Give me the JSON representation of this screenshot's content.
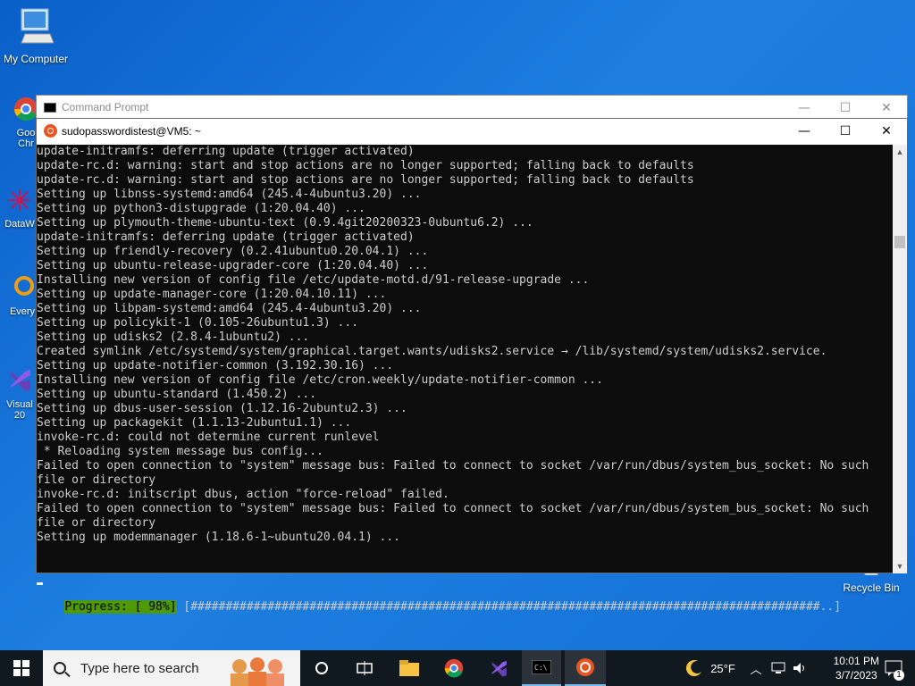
{
  "desktop": {
    "icons": [
      {
        "label": "My Computer"
      },
      {
        "label": "Goo Chr"
      },
      {
        "label": "DataW"
      },
      {
        "label": "Every"
      },
      {
        "label": "Visual 20"
      },
      {
        "label": "Recycle Bin"
      }
    ]
  },
  "outer_window": {
    "title": "Command Prompt",
    "controls": {
      "minimize": "—",
      "maximize": "☐",
      "close": "✕"
    }
  },
  "terminal_window": {
    "title": "sudopasswordistest@VM5: ~",
    "controls": {
      "minimize": "—",
      "maximize": "☐",
      "close": "✕"
    },
    "lines": [
      "update-initramfs: deferring update (trigger activated)",
      "update-rc.d: warning: start and stop actions are no longer supported; falling back to defaults",
      "update-rc.d: warning: start and stop actions are no longer supported; falling back to defaults",
      "Setting up libnss-systemd:amd64 (245.4-4ubuntu3.20) ...",
      "Setting up python3-distupgrade (1:20.04.40) ...",
      "Setting up plymouth-theme-ubuntu-text (0.9.4git20200323-0ubuntu6.2) ...",
      "update-initramfs: deferring update (trigger activated)",
      "Setting up friendly-recovery (0.2.41ubuntu0.20.04.1) ...",
      "Setting up ubuntu-release-upgrader-core (1:20.04.40) ...",
      "Installing new version of config file /etc/update-motd.d/91-release-upgrade ...",
      "Setting up update-manager-core (1:20.04.10.11) ...",
      "Setting up libpam-systemd:amd64 (245.4-4ubuntu3.20) ...",
      "Setting up policykit-1 (0.105-26ubuntu1.3) ...",
      "Setting up udisks2 (2.8.4-1ubuntu2) ...",
      "Created symlink /etc/systemd/system/graphical.target.wants/udisks2.service → /lib/systemd/system/udisks2.service.",
      "Setting up update-notifier-common (3.192.30.16) ...",
      "Installing new version of config file /etc/cron.weekly/update-notifier-common ...",
      "Setting up ubuntu-standard (1.450.2) ...",
      "Setting up dbus-user-session (1.12.16-2ubuntu2.3) ...",
      "Setting up packagekit (1.1.13-2ubuntu1.1) ...",
      "invoke-rc.d: could not determine current runlevel",
      " * Reloading system message bus config...",
      "Failed to open connection to \"system\" message bus: Failed to connect to socket /var/run/dbus/system_bus_socket: No such",
      "file or directory",
      "invoke-rc.d: initscript dbus, action \"force-reload\" failed.",
      "Failed to open connection to \"system\" message bus: Failed to connect to socket /var/run/dbus/system_bus_socket: No such",
      "file or directory",
      "Setting up modemmanager (1.18.6-1~ubuntu20.04.1) ..."
    ],
    "progress_label": "Progress: [ 98%]",
    "progress_bar": " [##########################################################################################..]",
    "progress_percent": 98
  },
  "taskbar": {
    "search_placeholder": "Type here to search",
    "icons": [
      "start-icon",
      "cortana-icon",
      "task-view-icon",
      "file-explorer-icon",
      "chrome-icon",
      "visual-studio-icon",
      "cmd-icon",
      "ubuntu-icon"
    ],
    "weather": "25°F",
    "time": "10:01 PM",
    "date": "3/7/2023",
    "notification_count": "1"
  }
}
